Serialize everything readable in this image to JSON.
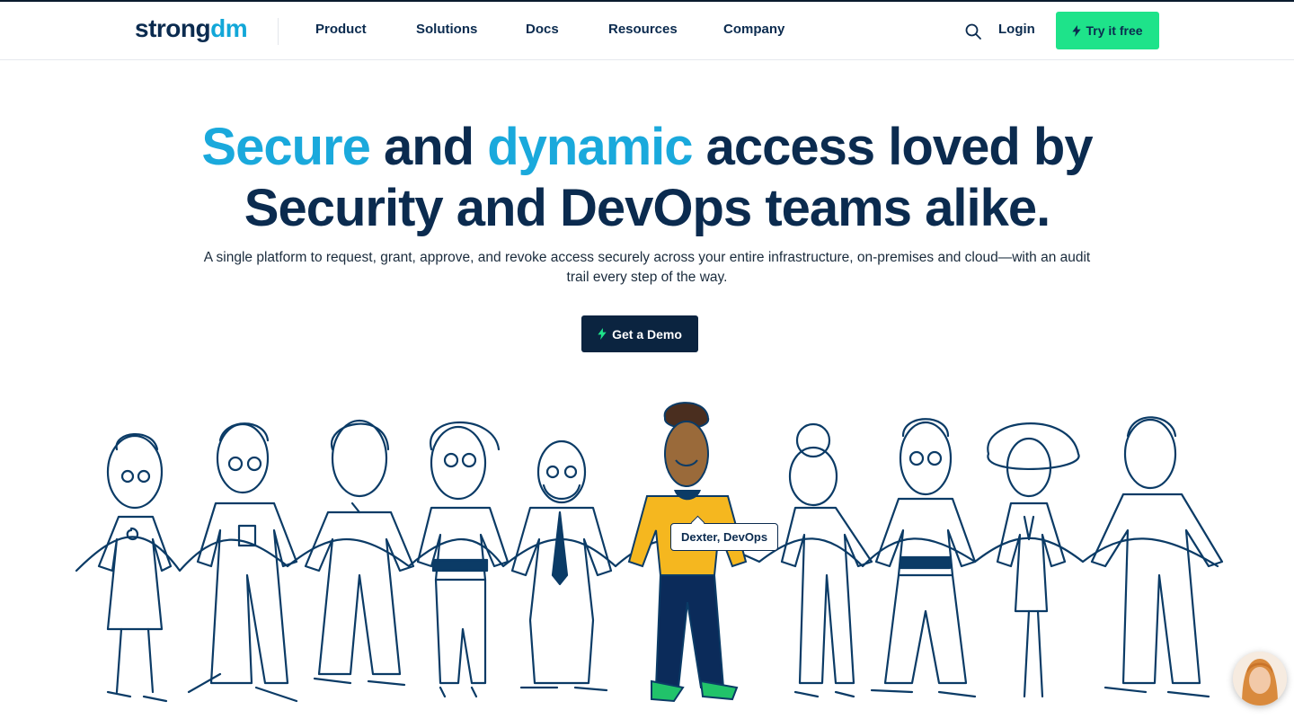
{
  "header": {
    "logo": {
      "main": "strong",
      "accent": "dm"
    },
    "nav": [
      {
        "label": "Product"
      },
      {
        "label": "Solutions"
      },
      {
        "label": "Docs"
      },
      {
        "label": "Resources"
      },
      {
        "label": "Company"
      }
    ],
    "search_icon": "search-icon",
    "login_label": "Login",
    "try_label": "Try it free"
  },
  "hero": {
    "title": {
      "w1": "Secure",
      "w2": " and ",
      "w3": "dynamic",
      "w4": " access loved by",
      "line2": "Security and DevOps teams alike."
    },
    "subtitle": "A single platform to request, grant, approve, and revoke access securely across your entire infrastructure, on-premises and cloud—with an audit trail every step of the way.",
    "demo_label": "Get a Demo"
  },
  "illustration": {
    "tooltip": "Dexter, DevOps",
    "highlight_colors": {
      "shirt": "#f5b71f",
      "pants": "#0b2b5a",
      "shoes": "#21c36a",
      "skin": "#9a6a3a"
    }
  },
  "colors": {
    "accent": "#1aa9dc",
    "brand_dark": "#0b2b4f",
    "cta_green": "#1ee38a"
  }
}
